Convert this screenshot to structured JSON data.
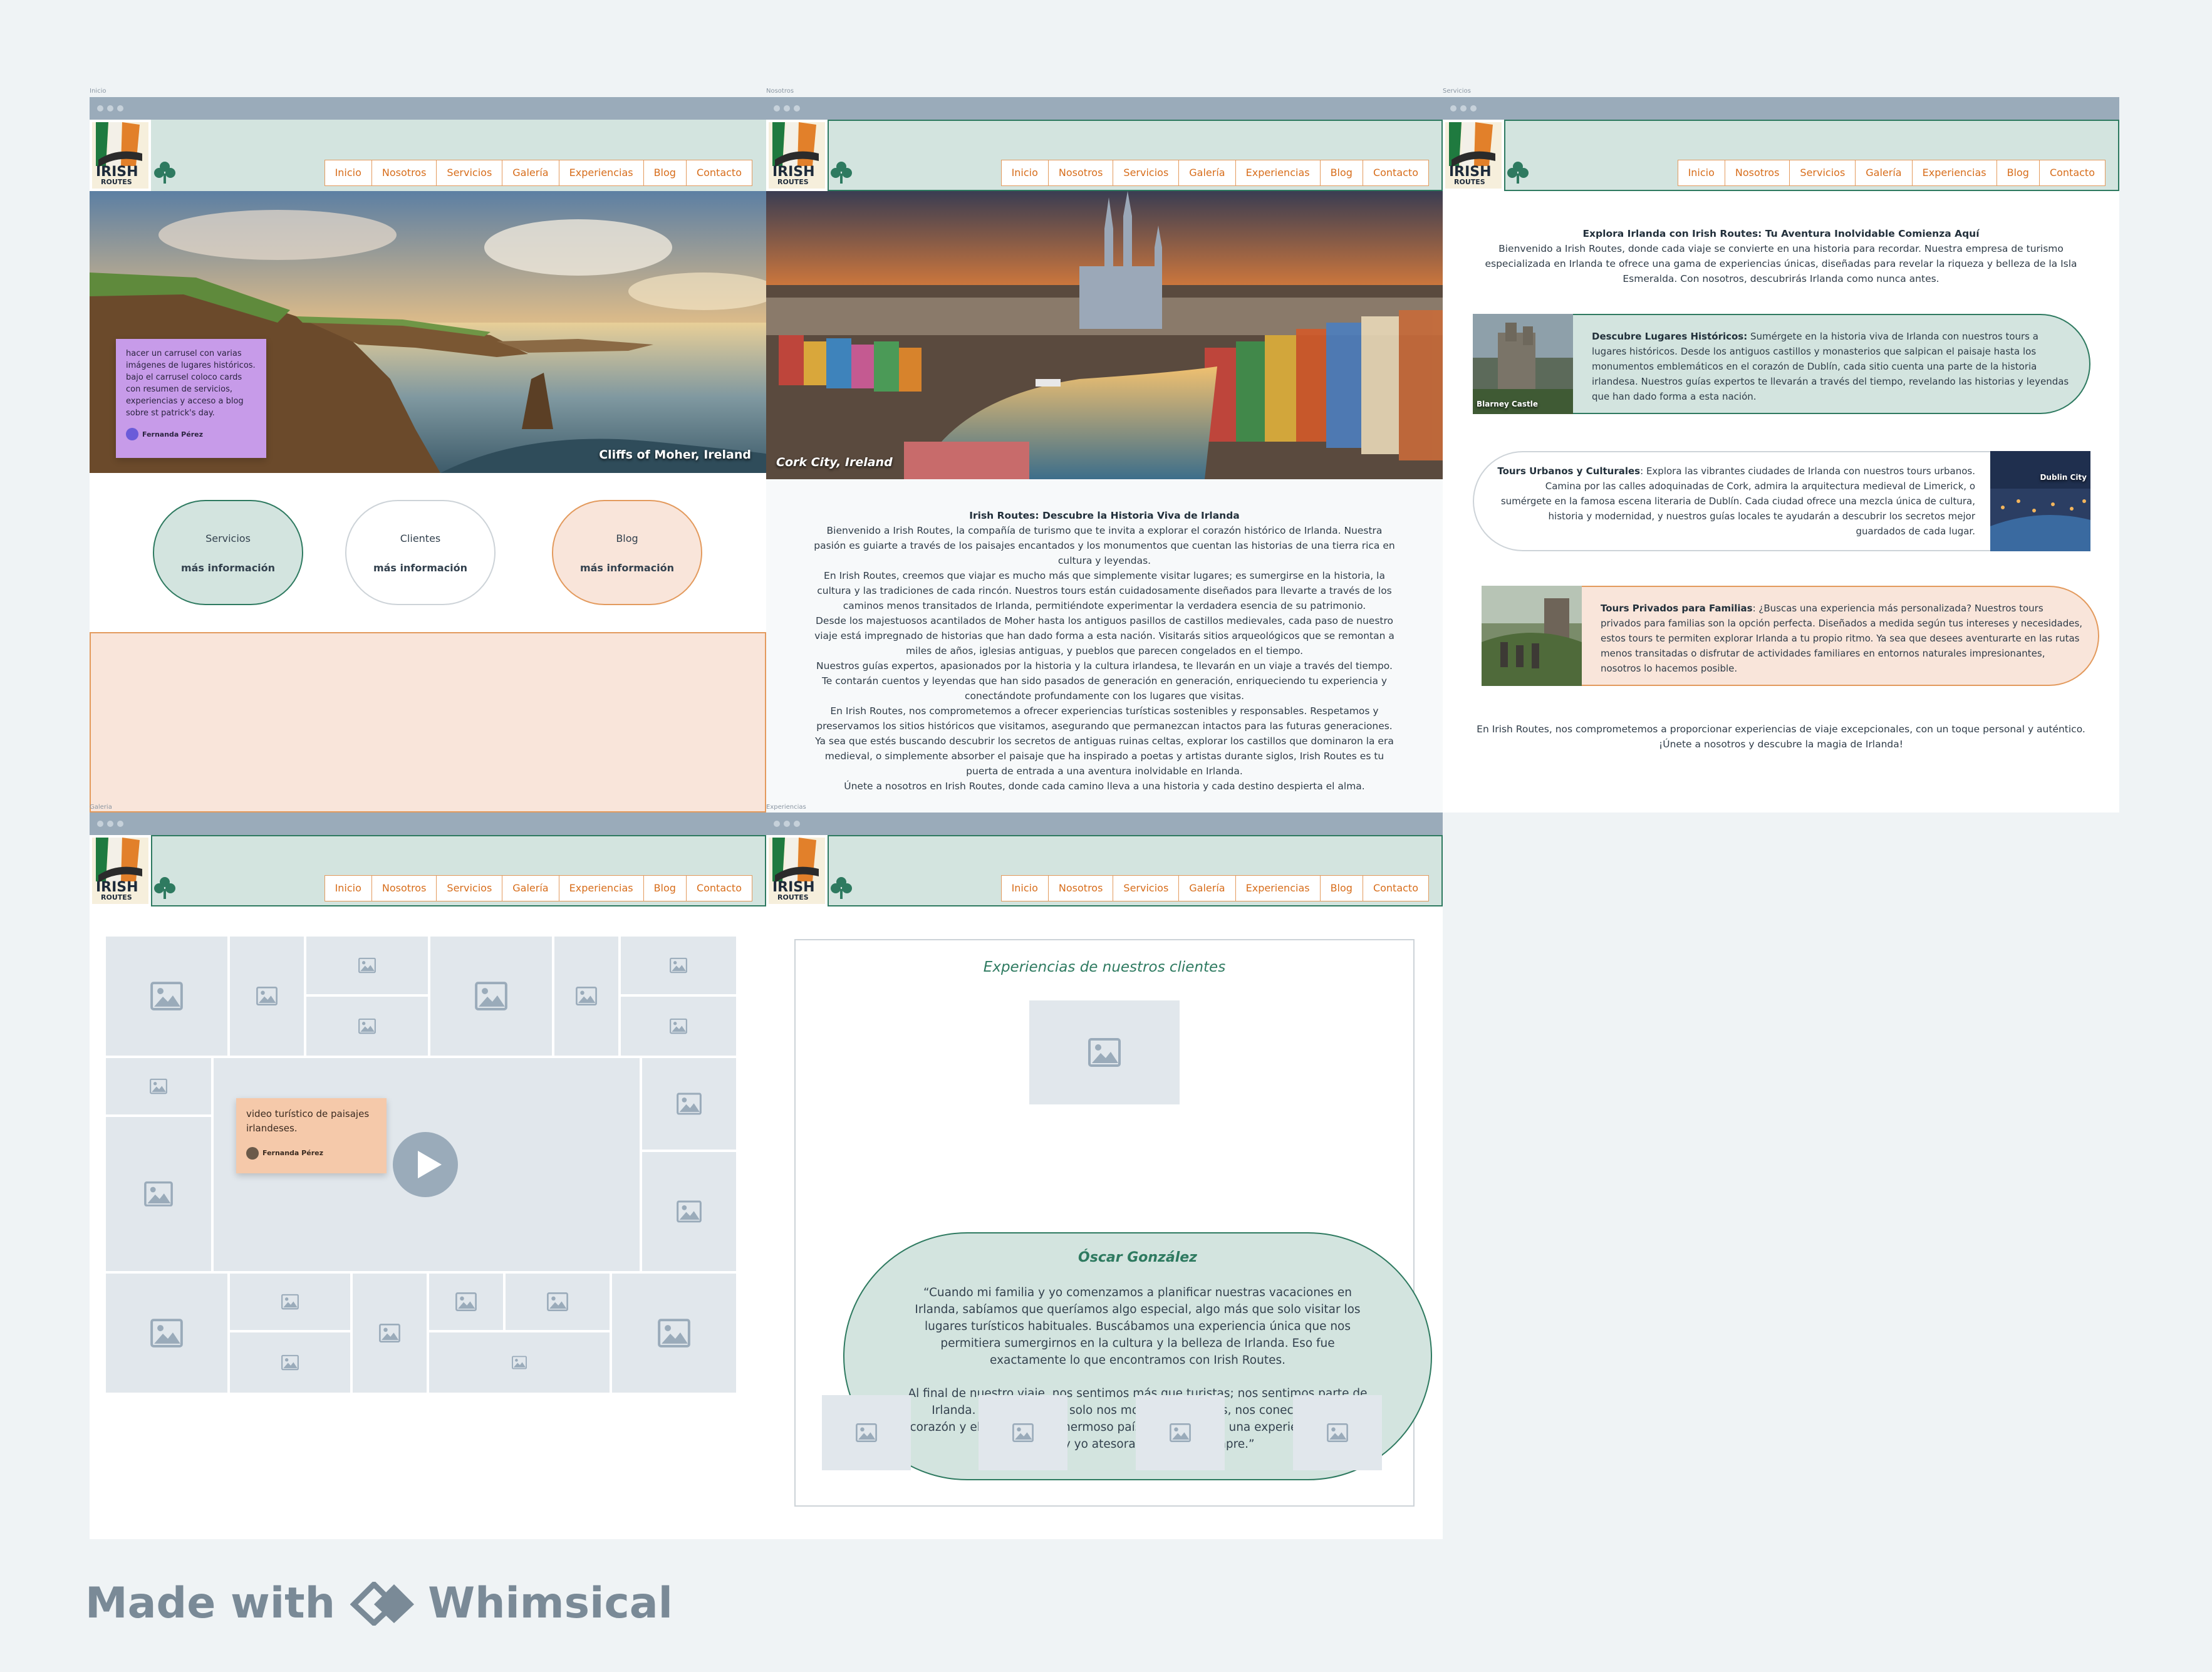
{
  "frames": {
    "inicio": {
      "label": "Inicio"
    },
    "nosotros": {
      "label": "Nosotros"
    },
    "servicios": {
      "label": "Servicios"
    },
    "galeria": {
      "label": "Galeria"
    },
    "experiencias": {
      "label": "Experiencias"
    }
  },
  "logo": {
    "line1": "IRISH",
    "line2": "ROUTES"
  },
  "nav": [
    "Inicio",
    "Nosotros",
    "Servicios",
    "Galería",
    "Experiencias",
    "Blog",
    "Contacto"
  ],
  "inicio": {
    "hero_caption": "Cliffs of Moher, Ireland",
    "note": "hacer un carrusel con varias imágenes de lugares históricos. bajo el carrusel coloco cards con resumen de servicios, experiencias y acceso a blog sobre st patrick's day.",
    "note_author": "Fernanda Pérez",
    "cards": [
      {
        "title": "Servicios",
        "more": "más información"
      },
      {
        "title": "Clientes",
        "more": "más información"
      },
      {
        "title": "Blog",
        "more": "más información"
      }
    ]
  },
  "nosotros": {
    "hero_caption": "Cork City, Ireland",
    "title": "Irish Routes: Descubre la Historia Viva de Irlanda",
    "paragraphs": [
      "Bienvenido a Irish Routes, la compañía de turismo que te invita a explorar el corazón histórico de Irlanda. Nuestra pasión es guiarte a través de los paisajes encantados y los monumentos que cuentan las historias de una tierra rica en cultura y leyendas.",
      "En Irish Routes, creemos que viajar es mucho más que simplemente visitar lugares; es sumergirse en la historia, la cultura y las tradiciones de cada rincón. Nuestros tours están cuidadosamente diseñados para llevarte a través de los caminos menos transitados de Irlanda, permitiéndote experimentar la verdadera esencia de su patrimonio.",
      "Desde los majestuosos acantilados de Moher hasta los antiguos pasillos de castillos medievales, cada paso de nuestro viaje está impregnado de historias que han dado forma a esta nación. Visitarás sitios arqueológicos que se remontan a miles de años, iglesias antiguas, y pueblos que parecen congelados en el tiempo.",
      "Nuestros guías expertos, apasionados por la historia y la cultura irlandesa, te llevarán en un viaje a través del tiempo. Te contarán cuentos y leyendas que han sido pasados de generación en generación, enriqueciendo tu experiencia y conectándote profundamente con los lugares que visitas.",
      "En Irish Routes, nos comprometemos a ofrecer experiencias turísticas sostenibles y responsables. Respetamos y preservamos los sitios históricos que visitamos, asegurando que permanezcan intactos para las futuras generaciones.",
      "Ya sea que estés buscando descubrir los secretos de antiguas ruinas celtas, explorar los castillos que dominaron la era medieval, o simplemente absorber el paisaje que ha inspirado a poetas y artistas durante siglos, Irish Routes es tu puerta de entrada a una aventura inolvidable en Irlanda.",
      "Únete a nosotros en Irish Routes, donde cada camino lleva a una historia y cada destino despierta el alma."
    ]
  },
  "servicios": {
    "title": "Explora Irlanda con Irish Routes: Tu Aventura Inolvidable Comienza Aquí",
    "intro": "Bienvenido a Irish Routes, donde cada viaje se convierte en una historia para recordar. Nuestra empresa de turismo especializada en Irlanda te ofrece una gama de experiencias únicas, diseñadas para revelar la riqueza y belleza de la Isla Esmeralda. Con nosotros, descubrirás Irlanda como nunca antes.",
    "items": [
      {
        "title": "Descubre Lugares Históricos:",
        "text": " Sumérgete en la historia viva de Irlanda con nuestros tours a lugares históricos. Desde los antiguos castillos y monasterios que salpican el paisaje hasta los monumentos emblemáticos en el corazón de Dublín, cada sitio cuenta una parte de la historia irlandesa. Nuestros guías expertos te llevarán a través del tiempo, revelando las historias y leyendas que han dado forma a esta nación.",
        "img_caption": "Blarney Castle"
      },
      {
        "title": "Tours Urbanos y Culturales",
        "text": ": Explora las vibrantes ciudades de Irlanda con nuestros tours urbanos. Camina por las calles adoquinadas de Cork, admira la arquitectura medieval de Limerick, o sumérgete en la famosa escena literaria de Dublín. Cada ciudad ofrece una mezcla única de cultura, historia y modernidad, y nuestros guías locales te ayudarán a descubrir los secretos mejor guardados de cada lugar.",
        "img_caption": "Dublin City"
      },
      {
        "title": "Tours Privados para Familias",
        "text": ": ¿Buscas una experiencia más personalizada? Nuestros tours privados para familias son la opción perfecta. Diseñados a medida según tus intereses y necesidades, estos tours te permiten explorar Irlanda a tu propio ritmo. Ya sea que desees aventurarte en las rutas menos transitadas o disfrutar de actividades familiares en entornos naturales impresionantes, nosotros lo hacemos posible.",
        "img_caption": ""
      }
    ],
    "closing": "En Irish Routes, nos comprometemos a proporcionar experiencias de viaje excepcionales, con un toque personal y auténtico. ¡Únete a nosotros y descubre la magia de Irlanda!"
  },
  "galeria": {
    "note": "video turístico de paisajes irlandeses.",
    "note_author": "Fernanda Pérez"
  },
  "experiencias": {
    "heading": "Experiencias de nuestros clientes",
    "name": "Óscar González",
    "quote1": "“Cuando mi familia y yo comenzamos a planificar nuestras vacaciones en Irlanda, sabíamos que queríamos algo especial, algo más que solo visitar los lugares turísticos habituales. Buscábamos una experiencia única que nos permitiera sumergirnos en la cultura y la belleza de Irlanda. Eso fue exactamente lo que encontramos con Irish Routes.",
    "quote2": "Al final de nuestro viaje, nos sentimos más que turistas; nos sentimos parte de Irlanda. Irish Routes no solo nos mostró los lugares, nos conectó con el corazón y el alma de este hermoso país. Sin duda, fue una experiencia que mi familia y yo atesoraremos por siempre.”"
  },
  "footer_brand": {
    "made_with": "Made with",
    "name": "Whimsical"
  },
  "colors": {
    "accent": "#d76d1b",
    "green": "#2e7a60",
    "mint": "#d3e4df",
    "peach": "#f9e5da",
    "purple": "#c79be9",
    "note_peach": "#f5c9aa",
    "placeholder": "#e1e7ec",
    "titlebar": "#9aabba"
  }
}
